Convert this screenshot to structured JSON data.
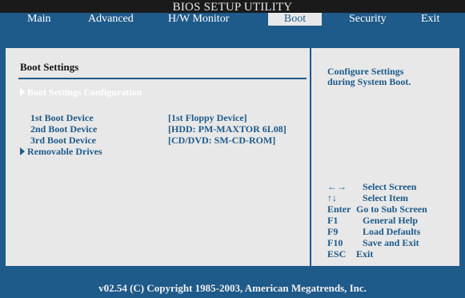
{
  "title": "BIOS SETUP UTILITY",
  "tabs": [
    {
      "label": "Main"
    },
    {
      "label": "Advanced"
    },
    {
      "label": "H/W Monitor"
    },
    {
      "label": "Boot"
    },
    {
      "label": "Security"
    },
    {
      "label": "Exit"
    }
  ],
  "main": {
    "section_title": "Boot Settings",
    "menu_config_label": "Boot Settings Configuration",
    "rows": [
      {
        "label": "1st Boot Device",
        "value": "[1st Floppy Device]"
      },
      {
        "label": "2nd Boot Device",
        "value": "[HDD: PM-MAXTOR 6L08]"
      },
      {
        "label": "3rd Boot Device",
        "value": "[CD/DVD: SM-CD-ROM]"
      }
    ],
    "removable_label": "Removable Drives"
  },
  "help": {
    "line1": "Configure Settings",
    "line2": "during System Boot.",
    "keys": [
      {
        "key": "←→",
        "desc": "Select Screen"
      },
      {
        "key": "↑↓",
        "desc": "Select Item"
      },
      {
        "key": "Enter",
        "desc": "Go to Sub Screen"
      },
      {
        "key": "F1",
        "desc": "General Help"
      },
      {
        "key": "F9",
        "desc": "Load Defaults"
      },
      {
        "key": "F10",
        "desc": "Save and Exit"
      },
      {
        "key": "ESC",
        "desc": "Exit"
      }
    ]
  },
  "footer": "v02.54 (C) Copyright 1985-2003, American Megatrends, Inc.",
  "colors": {
    "blue": "#1e5a8a",
    "panel": "#e8e8e8",
    "title_bg": "#1a1a1a"
  }
}
